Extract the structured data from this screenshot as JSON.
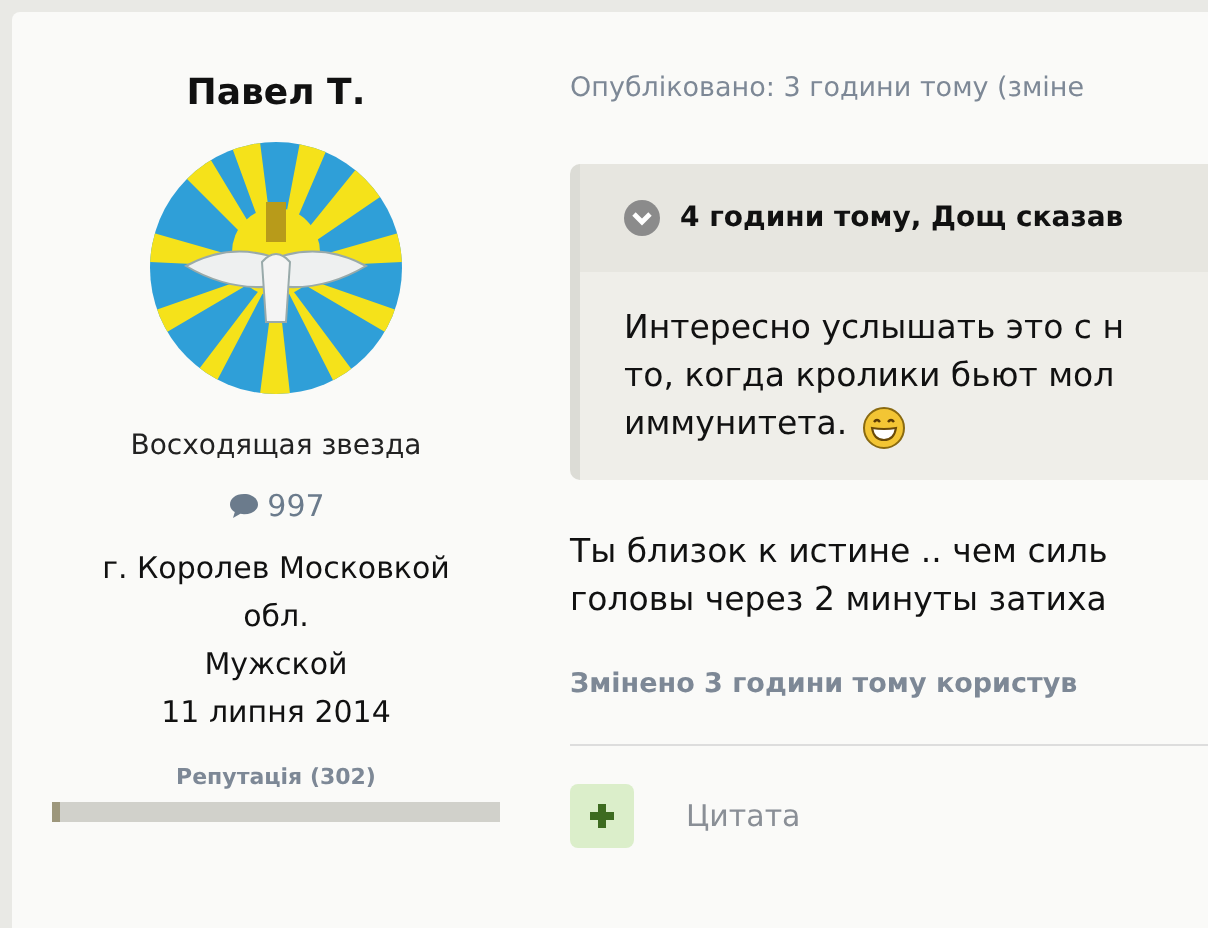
{
  "author": {
    "name": "Павел Т.",
    "rank": "Восходящая звезда",
    "posts": "997",
    "info": [
      "г. Королев Московкой\nобл.",
      "Мужской",
      "11 липня 2014"
    ],
    "reputation": {
      "label": "Репутація (302)",
      "level": 0.02
    }
  },
  "post": {
    "published": "Опубліковано: 3 години тому (зміне",
    "quote": {
      "expanded": true,
      "header": "4 години тому, Дощ сказав",
      "lines": [
        "Интересно услышать это с н",
        "то, когда кролики бьют мол",
        "иммунитета."
      ]
    },
    "body": "Ты близок к истине .. чем силь\nголовы через 2 минуты затиха",
    "edited": "Змінено 3 години тому користув",
    "actions": [
      {
        "kind": "add"
      },
      {
        "kind": "quote",
        "label": "Цитата"
      }
    ]
  }
}
